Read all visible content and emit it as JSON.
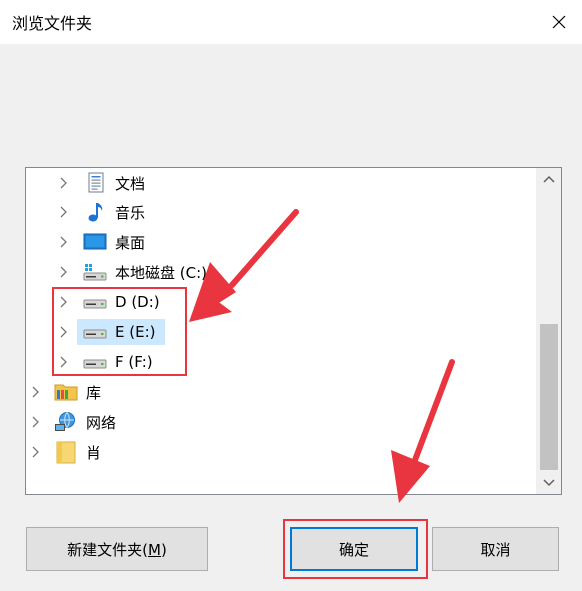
{
  "window": {
    "title": "浏览文件夹"
  },
  "tree": {
    "items": [
      {
        "label": "文档",
        "icon": "documents-icon"
      },
      {
        "label": "音乐",
        "icon": "music-icon"
      },
      {
        "label": "桌面",
        "icon": "desktop-icon"
      },
      {
        "label": "本地磁盘 (C:)",
        "icon": "system-drive-icon"
      },
      {
        "label": "D (D:)",
        "icon": "drive-icon"
      },
      {
        "label": "E (E:)",
        "icon": "drive-icon"
      },
      {
        "label": "F (F:)",
        "icon": "drive-icon"
      },
      {
        "label": "库",
        "icon": "library-icon"
      },
      {
        "label": "网络",
        "icon": "network-icon"
      },
      {
        "label": "肖",
        "icon": "folder-icon"
      }
    ],
    "selected": "E (E:)"
  },
  "buttons": {
    "new_folder_text": "新建文件夹(",
    "new_folder_mnemonic": "M",
    "new_folder_suffix": ")",
    "ok": "确定",
    "cancel": "取消"
  },
  "colors": {
    "selection": "#cce8ff",
    "default_button_border": "#0078d7",
    "annotation_red": "#e8353f"
  }
}
